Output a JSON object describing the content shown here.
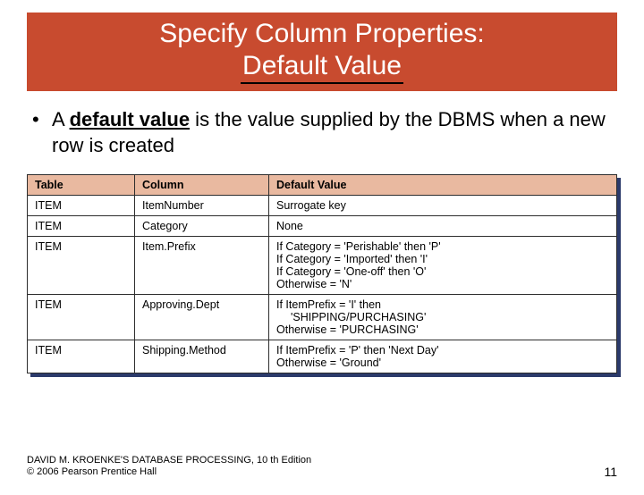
{
  "title": {
    "line1": "Specify Column Properties:",
    "line2": "Default Value"
  },
  "bullet": {
    "prefix_a": "A ",
    "bold_underlined": "default value",
    "rest": " is the value supplied by the DBMS when a new row is created"
  },
  "table": {
    "headers": {
      "c1": "Table",
      "c2": "Column",
      "c3": "Default Value"
    },
    "rows": [
      {
        "c1": "ITEM",
        "c2": "ItemNumber",
        "c3": [
          "Surrogate key"
        ]
      },
      {
        "c1": "ITEM",
        "c2": "Category",
        "c3": [
          "None"
        ]
      },
      {
        "c1": "ITEM",
        "c2": "Item.Prefix",
        "c3": [
          "If Category = 'Perishable' then 'P'",
          "If Category = 'Imported' then 'I'",
          "If Category = 'One-off' then 'O'",
          "Otherwise = 'N'"
        ]
      },
      {
        "c1": "ITEM",
        "c2": "Approving.Dept",
        "c3": [
          "If ItemPrefix = 'I' then",
          "    'SHIPPING/PURCHASING'",
          "Otherwise = 'PURCHASING'"
        ]
      },
      {
        "c1": "ITEM",
        "c2": "Shipping.Method",
        "c3": [
          "If ItemPrefix = 'P' then 'Next Day'",
          "Otherwise = 'Ground'"
        ]
      }
    ]
  },
  "footer": {
    "line1": "DAVID M. KROENKE'S DATABASE PROCESSING, 10 th Edition",
    "line2": "© 2006 Pearson Prentice Hall",
    "page": "11"
  }
}
